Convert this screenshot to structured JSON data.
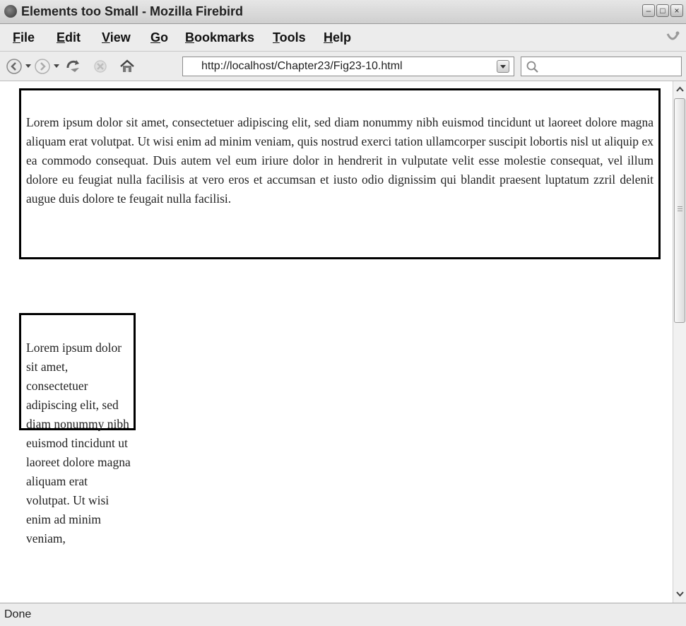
{
  "window": {
    "title": "Elements too Small - Mozilla Firebird"
  },
  "menu": {
    "items": [
      "File",
      "Edit",
      "View",
      "Go",
      "Bookmarks",
      "Tools",
      "Help"
    ]
  },
  "nav": {
    "url": "http://localhost/Chapter23/Fig23-10.html",
    "search_placeholder": ""
  },
  "content": {
    "box1_text": "Lorem ipsum dolor sit amet, consectetuer adipiscing elit, sed diam nonummy nibh euismod tincidunt ut laoreet dolore magna aliquam erat volutpat. Ut wisi enim ad minim veniam, quis nostrud exerci tation ullamcorper suscipit lobortis nisl ut aliquip ex ea commodo consequat. Duis autem vel eum iriure dolor in hendrerit in vulputate velit esse molestie consequat, vel illum dolore eu feugiat nulla facilisis at vero eros et accumsan et iusto odio dignissim qui blandit praesent luptatum zzril delenit augue duis dolore te feugait nulla facilisi.",
    "box2_text": "Lorem ipsum dolor sit amet, consectetuer adipiscing elit, sed diam nonummy nibh euismod tincidunt ut laoreet dolore magna aliquam erat volutpat. Ut wisi enim ad minim veniam,"
  },
  "status": {
    "text": "Done"
  }
}
